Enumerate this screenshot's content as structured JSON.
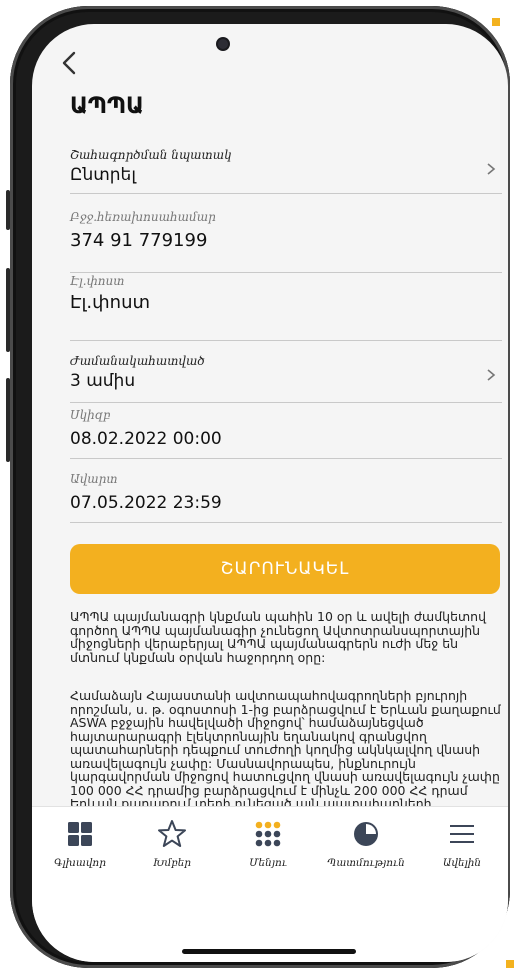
{
  "page": {
    "title": "ԱՊՊԱ",
    "colors": {
      "accent": "#f3b01f",
      "screen_bg": "#f5f5f5",
      "text": "#111111"
    }
  },
  "header": {
    "back_icon": "chevron-left-icon"
  },
  "form": {
    "purpose_label": "Շահագործման նպատակ",
    "purpose_value": "Ընտրել",
    "phone_label": "Բջջ.հեռախոսահամար",
    "phone_value": "374 91 779199",
    "email_label": "Էլ.փոստ",
    "email_value": "Էլ.փոստ",
    "period_label": "Ժամանակահատված",
    "period_value": "3 ամիս",
    "start_label": "Սկիզբ",
    "start_value": "08.02.2022 00:00",
    "end_label": "Ավարտ",
    "end_value": "07.05.2022 23:59"
  },
  "cta": {
    "label": "ՇԱՐՈՒՆԱԿԵԼ"
  },
  "info": {
    "paragraph1": "ԱՊՊԱ պայմանագրի կնքման պահին 10 օր և ավելի ժամկետով գործող ԱՊՊԱ պայմանագիր չունեցող Ավտոտրանսպորտային միջոցների վերաբերյալ ԱՊՊԱ պայմանագրերն ուժի մեջ են մտնում կնքման օրվան հաջորդող օրը:",
    "paragraph2": "Համաձայն Հայաստանի ավտոապահովագրողների բյուրոյի որոշման, ս. թ. օգոստոսի 1-ից բարձրացվում է Երևան քաղաքում ASWA բջջային հավելվածի միջոցով՝ համաձայնեցված հայտարարագրի էլեկտրոնային եղանակով գրանցվող պատահարների դեպքում տուժողի կողմից ակնկալվող վնասի առավելագույն չափը: Մասնավորապես, ինքնուրույն կարգավորման միջոցով հատուցվող վնասի առավելագույն չափը 100 000 ՀՀ դրամից բարձրացվում է մինչև 200 000 ՀՀ դրամ Երևան քաղաքում տեղի ունեցած այն պատահարների վերաբերյալ, որոնք վերաբերում"
  },
  "tabbar": {
    "items": [
      {
        "label": "Գլխավոր",
        "icon": "dashboard-grid-icon"
      },
      {
        "label": "Խմբեր",
        "icon": "star-icon"
      },
      {
        "label": "Մենյու",
        "icon": "dots-grid-icon"
      },
      {
        "label": "Պատմություն",
        "icon": "pie-chart-icon"
      },
      {
        "label": "Ավելին",
        "icon": "hamburger-menu-icon"
      }
    ]
  }
}
